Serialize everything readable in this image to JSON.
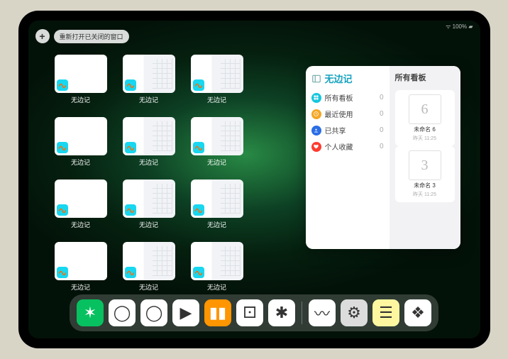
{
  "status": {
    "indicators": "ᯤ 100% ▰"
  },
  "topbar": {
    "plus": "+",
    "reopen_label": "重新打开已关闭的窗口"
  },
  "app": {
    "name": "无边记"
  },
  "expose": {
    "windows": [
      {
        "label": "无边记",
        "hasCal": false
      },
      {
        "label": "无边记",
        "hasCal": true
      },
      {
        "label": "无边记",
        "hasCal": true
      },
      null,
      {
        "label": "无边记",
        "hasCal": false
      },
      {
        "label": "无边记",
        "hasCal": true
      },
      {
        "label": "无边记",
        "hasCal": true
      },
      null,
      {
        "label": "无边记",
        "hasCal": false
      },
      {
        "label": "无边记",
        "hasCal": true
      },
      {
        "label": "无边记",
        "hasCal": true
      },
      null,
      {
        "label": "无边记",
        "hasCal": false
      },
      {
        "label": "无边记",
        "hasCal": true
      },
      {
        "label": "无边记",
        "hasCal": true
      },
      null
    ]
  },
  "panel": {
    "more": "…",
    "title": "无边记",
    "sidebar": [
      {
        "icon": "grid",
        "color": "#16c6dd",
        "label": "所有看板",
        "count": 0
      },
      {
        "icon": "clock",
        "color": "#f5a623",
        "label": "最近使用",
        "count": 0
      },
      {
        "icon": "share",
        "color": "#2b6ee6",
        "label": "已共享",
        "count": 0
      },
      {
        "icon": "heart",
        "color": "#ff3b30",
        "label": "个人收藏",
        "count": 0
      }
    ],
    "right_title": "所有看板",
    "boards": [
      {
        "glyph": "6",
        "name": "未命名 6",
        "sub": "昨天 11:25"
      },
      {
        "glyph": "3",
        "name": "未命名 3",
        "sub": "昨天 11:25"
      }
    ]
  },
  "dock": {
    "apps": [
      {
        "name": "wechat",
        "bg": "#07c160",
        "glyph": "✶"
      },
      {
        "name": "quark1",
        "bg": "#ffffff",
        "glyph": "◯"
      },
      {
        "name": "quark2",
        "bg": "#ffffff",
        "glyph": "◯"
      },
      {
        "name": "play",
        "bg": "#ffffff",
        "glyph": "▶"
      },
      {
        "name": "books",
        "bg": "#ff9500",
        "glyph": "▮▮"
      },
      {
        "name": "dice",
        "bg": "#ffffff",
        "glyph": "⚀"
      },
      {
        "name": "node",
        "bg": "#ffffff",
        "glyph": "✱"
      }
    ],
    "recent": [
      {
        "name": "freeform",
        "bg": "#ffffff",
        "glyph": "〰"
      },
      {
        "name": "settings",
        "bg": "#dcdcdc",
        "glyph": "⚙"
      },
      {
        "name": "notes",
        "bg": "#fff7a0",
        "glyph": "☰"
      },
      {
        "name": "folder",
        "bg": "#ffffff",
        "glyph": "❖"
      }
    ]
  }
}
